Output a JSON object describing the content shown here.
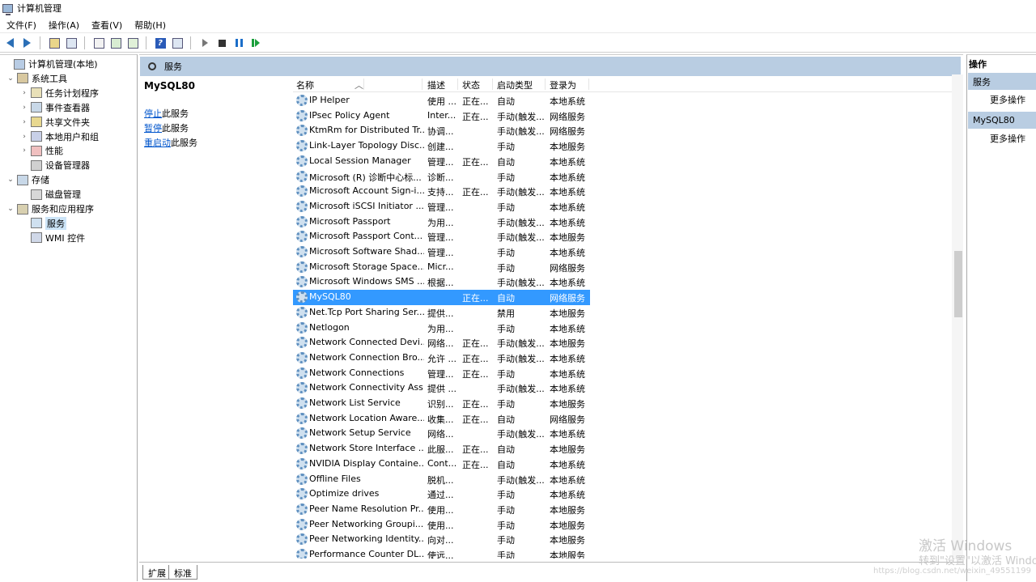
{
  "window": {
    "title": "计算机管理"
  },
  "menu": [
    "文件(F)",
    "操作(A)",
    "查看(V)",
    "帮助(H)"
  ],
  "toolbar": [
    "back-icon",
    "forward-icon",
    "up-icon",
    "show-tree-icon",
    "export-icon",
    "refresh-icon",
    "export-list-icon",
    "help-icon",
    "properties-icon",
    "start-service-icon",
    "stop-service-icon",
    "pause-service-icon",
    "restart-service-icon"
  ],
  "tree": {
    "items": [
      {
        "label": "计算机管理(本地)",
        "icon": "computer-icon",
        "level": 0,
        "expander": ""
      },
      {
        "label": "系统工具",
        "icon": "tools-icon",
        "level": 1,
        "expander": "⌄"
      },
      {
        "label": "任务计划程序",
        "icon": "clock-icon",
        "level": 2,
        "expander": "›"
      },
      {
        "label": "事件查看器",
        "icon": "event-viewer-icon",
        "level": 2,
        "expander": "›"
      },
      {
        "label": "共享文件夹",
        "icon": "shared-folder-icon",
        "level": 2,
        "expander": "›"
      },
      {
        "label": "本地用户和组",
        "icon": "users-icon",
        "level": 2,
        "expander": "›"
      },
      {
        "label": "性能",
        "icon": "performance-icon",
        "level": 2,
        "expander": "›"
      },
      {
        "label": "设备管理器",
        "icon": "device-manager-icon",
        "level": 2,
        "expander": ""
      },
      {
        "label": "存储",
        "icon": "storage-icon",
        "level": 1,
        "expander": "⌄"
      },
      {
        "label": "磁盘管理",
        "icon": "disk-icon",
        "level": 2,
        "expander": ""
      },
      {
        "label": "服务和应用程序",
        "icon": "services-apps-icon",
        "level": 1,
        "expander": "⌄"
      },
      {
        "label": "服务",
        "icon": "services-icon",
        "level": 2,
        "expander": "",
        "selected": true
      },
      {
        "label": "WMI 控件",
        "icon": "wmi-icon",
        "level": 2,
        "expander": ""
      }
    ]
  },
  "center": {
    "header": "服务",
    "detail": {
      "service_name": "MySQL80",
      "actions": [
        {
          "link": "停止",
          "rest": "此服务"
        },
        {
          "link": "暂停",
          "rest": "此服务"
        },
        {
          "link": "重启动",
          "rest": "此服务"
        }
      ]
    },
    "columns": [
      "名称",
      "描述",
      "状态",
      "启动类型",
      "登录为"
    ],
    "rows": [
      {
        "name": "IP Helper",
        "desc": "使用 ...",
        "status": "正在...",
        "startup": "自动",
        "logon": "本地系统"
      },
      {
        "name": "IPsec Policy Agent",
        "desc": "Inter...",
        "status": "正在...",
        "startup": "手动(触发...",
        "logon": "网络服务"
      },
      {
        "name": "KtmRm for Distributed Tr...",
        "desc": "协调...",
        "status": "",
        "startup": "手动(触发...",
        "logon": "网络服务"
      },
      {
        "name": "Link-Layer Topology Disc...",
        "desc": "创建...",
        "status": "",
        "startup": "手动",
        "logon": "本地服务"
      },
      {
        "name": "Local Session Manager",
        "desc": "管理...",
        "status": "正在...",
        "startup": "自动",
        "logon": "本地系统"
      },
      {
        "name": "Microsoft (R) 诊断中心标...",
        "desc": "诊断...",
        "status": "",
        "startup": "手动",
        "logon": "本地系统"
      },
      {
        "name": "Microsoft Account Sign-i...",
        "desc": "支持...",
        "status": "正在...",
        "startup": "手动(触发...",
        "logon": "本地系统"
      },
      {
        "name": "Microsoft iSCSI Initiator ...",
        "desc": "管理...",
        "status": "",
        "startup": "手动",
        "logon": "本地系统"
      },
      {
        "name": "Microsoft Passport",
        "desc": "为用...",
        "status": "",
        "startup": "手动(触发...",
        "logon": "本地系统"
      },
      {
        "name": "Microsoft Passport Cont...",
        "desc": "管理...",
        "status": "",
        "startup": "手动(触发...",
        "logon": "本地服务"
      },
      {
        "name": "Microsoft Software Shad...",
        "desc": "管理...",
        "status": "",
        "startup": "手动",
        "logon": "本地系统"
      },
      {
        "name": "Microsoft Storage Space...",
        "desc": "Micr...",
        "status": "",
        "startup": "手动",
        "logon": "网络服务"
      },
      {
        "name": "Microsoft Windows SMS ...",
        "desc": "根据...",
        "status": "",
        "startup": "手动(触发...",
        "logon": "本地系统"
      },
      {
        "name": "MySQL80",
        "desc": "",
        "status": "正在...",
        "startup": "自动",
        "logon": "网络服务",
        "selected": true
      },
      {
        "name": "Net.Tcp Port Sharing Ser...",
        "desc": "提供...",
        "status": "",
        "startup": "禁用",
        "logon": "本地服务"
      },
      {
        "name": "Netlogon",
        "desc": "为用...",
        "status": "",
        "startup": "手动",
        "logon": "本地系统"
      },
      {
        "name": "Network Connected Devi...",
        "desc": "网络...",
        "status": "正在...",
        "startup": "手动(触发...",
        "logon": "本地服务"
      },
      {
        "name": "Network Connection Bro...",
        "desc": "允许 ...",
        "status": "正在...",
        "startup": "手动(触发...",
        "logon": "本地系统"
      },
      {
        "name": "Network Connections",
        "desc": "管理...",
        "status": "正在...",
        "startup": "手动",
        "logon": "本地系统"
      },
      {
        "name": "Network Connectivity Ass...",
        "desc": "提供 ...",
        "status": "",
        "startup": "手动(触发...",
        "logon": "本地系统"
      },
      {
        "name": "Network List Service",
        "desc": "识别...",
        "status": "正在...",
        "startup": "手动",
        "logon": "本地服务"
      },
      {
        "name": "Network Location Aware...",
        "desc": "收集...",
        "status": "正在...",
        "startup": "自动",
        "logon": "网络服务"
      },
      {
        "name": "Network Setup Service",
        "desc": "网络...",
        "status": "",
        "startup": "手动(触发...",
        "logon": "本地系统"
      },
      {
        "name": "Network Store Interface ...",
        "desc": "此服...",
        "status": "正在...",
        "startup": "自动",
        "logon": "本地服务"
      },
      {
        "name": "NVIDIA Display Containe...",
        "desc": "Cont...",
        "status": "正在...",
        "startup": "自动",
        "logon": "本地系统"
      },
      {
        "name": "Offline Files",
        "desc": "脱机...",
        "status": "",
        "startup": "手动(触发...",
        "logon": "本地系统"
      },
      {
        "name": "Optimize drives",
        "desc": "通过...",
        "status": "",
        "startup": "手动",
        "logon": "本地系统"
      },
      {
        "name": "Peer Name Resolution Pr...",
        "desc": "使用...",
        "status": "",
        "startup": "手动",
        "logon": "本地服务"
      },
      {
        "name": "Peer Networking Groupi...",
        "desc": "使用...",
        "status": "",
        "startup": "手动",
        "logon": "本地服务"
      },
      {
        "name": "Peer Networking Identity...",
        "desc": "向对...",
        "status": "",
        "startup": "手动",
        "logon": "本地服务"
      },
      {
        "name": "Performance Counter DL...",
        "desc": "使远...",
        "status": "",
        "startup": "手动",
        "logon": "本地服务"
      }
    ],
    "tabs": [
      "扩展",
      "标准"
    ]
  },
  "actions_pane": {
    "title": "操作",
    "sections": [
      {
        "header": "服务",
        "item": "更多操作"
      },
      {
        "header": "MySQL80",
        "item": "更多操作"
      }
    ]
  },
  "watermark": {
    "line1": "激活 Windows",
    "line2": "转到\"设置\"以激活 Windo",
    "line3": "https://blog.csdn.net/weixin_49551199"
  },
  "colors": {
    "selection": "#3399ff",
    "header_band": "#b9cde2"
  }
}
